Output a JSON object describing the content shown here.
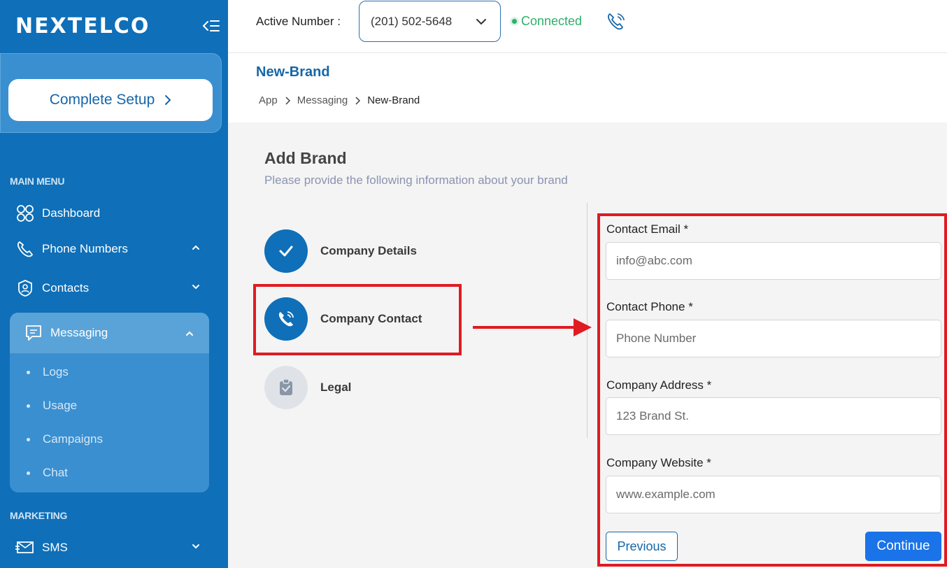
{
  "sidebar": {
    "logo": "NEXTELCO",
    "setup_button": "Complete Setup",
    "main_menu_label": "MAIN MENU",
    "items": [
      {
        "label": "Dashboard",
        "icon": "dashboard-grid-icon"
      },
      {
        "label": "Phone Numbers",
        "icon": "phone-icon"
      },
      {
        "label": "Contacts",
        "icon": "contacts-icon"
      }
    ],
    "messaging": {
      "label": "Messaging",
      "icon": "message-icon",
      "sub_items": [
        "Logs",
        "Usage",
        "Campaigns",
        "Chat"
      ]
    },
    "marketing_label": "MARKETING",
    "sms": {
      "label": "SMS",
      "icon": "sms-icon"
    }
  },
  "topbar": {
    "active_number_label": "Active Number :",
    "active_number": "(201) 502-5648",
    "status": "Connected"
  },
  "header": {
    "title": "New-Brand",
    "breadcrumb": [
      "App",
      "Messaging",
      "New-Brand"
    ]
  },
  "form": {
    "title": "Add Brand",
    "subtitle": "Please provide the following information about your brand",
    "steps": [
      {
        "label": "Company Details",
        "state": "done"
      },
      {
        "label": "Company Contact",
        "state": "active"
      },
      {
        "label": "Legal",
        "state": "pending"
      }
    ],
    "fields": [
      {
        "label": "Contact Email *",
        "placeholder": "info@abc.com"
      },
      {
        "label": "Contact Phone *",
        "placeholder": "Phone Number"
      },
      {
        "label": "Company Address *",
        "placeholder": "123 Brand St."
      },
      {
        "label": "Company Website *",
        "placeholder": "www.example.com"
      }
    ],
    "previous_label": "Previous",
    "continue_label": "Continue"
  },
  "colors": {
    "sidebar_bg": "#0f6fb8",
    "accent": "#1666a8",
    "button_blue": "#1a73e8",
    "connected": "#2fae6b",
    "highlight": "#e01b22"
  }
}
